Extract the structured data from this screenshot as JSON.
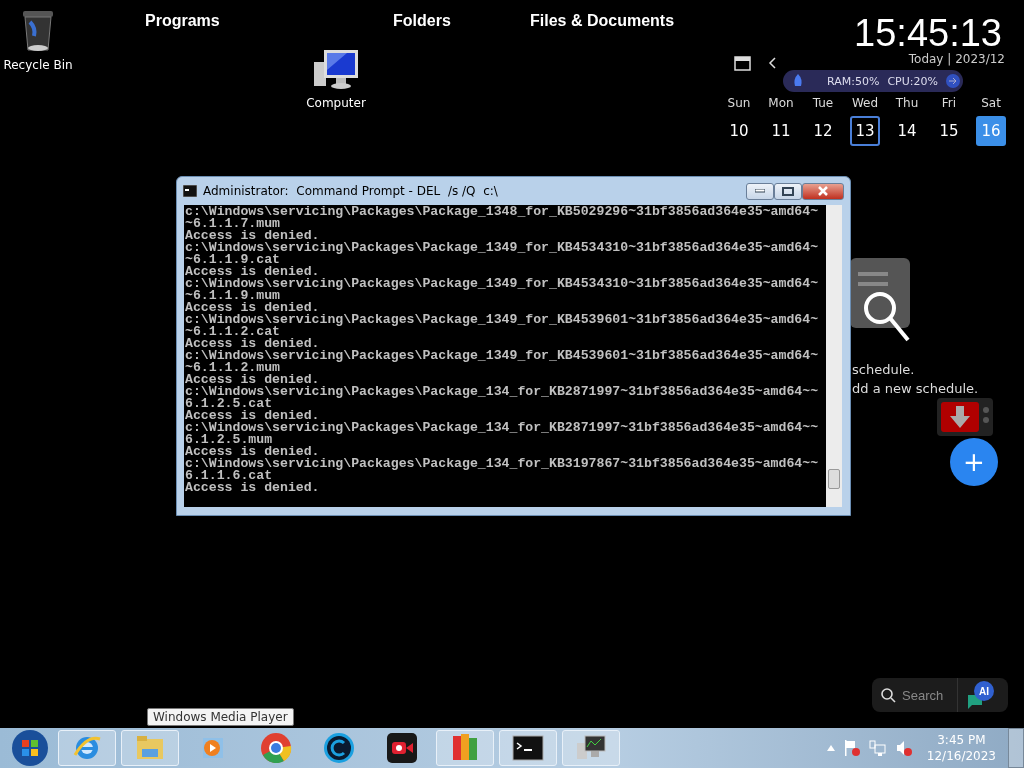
{
  "desktop_icons": [
    {
      "label": "Recycle Bin",
      "kind": "bin"
    },
    {
      "label": "Computer",
      "kind": "computer"
    }
  ],
  "launcher_tabs": [
    "Programs",
    "Folders",
    "Files & Documents"
  ],
  "clock_widget": {
    "time": "15:45:13",
    "header": "Today | 2023/12",
    "system_monitor": {
      "ram": "RAM:50%",
      "cpu": "CPU:20%"
    },
    "weekdays": [
      "Sun",
      "Mon",
      "Tue",
      "Wed",
      "Thu",
      "Fri",
      "Sat"
    ],
    "days": [
      {
        "day": "10",
        "today": false,
        "selected": false
      },
      {
        "day": "11",
        "today": false,
        "selected": false
      },
      {
        "day": "12",
        "today": false,
        "selected": false
      },
      {
        "day": "13",
        "today": true,
        "selected": false
      },
      {
        "day": "14",
        "today": false,
        "selected": false
      },
      {
        "day": "15",
        "today": false,
        "selected": false
      },
      {
        "day": "16",
        "today": false,
        "selected": true
      }
    ]
  },
  "schedule_widget": {
    "lines": [
      "schedule.",
      "dd a new schedule."
    ],
    "add_button": "+"
  },
  "console_window": {
    "title": "Administrator:  Command Prompt - DEL  /s /Q  c:\\",
    "lines": [
      "c:\\Windows\\servicing\\Packages\\Package_1348_for_KB5029296~31bf3856ad364e35~amd64~",
      "~6.1.1.7.mum",
      "Access is denied.",
      "c:\\Windows\\servicing\\Packages\\Package_1349_for_KB4534310~31bf3856ad364e35~amd64~",
      "~6.1.1.9.cat",
      "Access is denied.",
      "c:\\Windows\\servicing\\Packages\\Package_1349_for_KB4534310~31bf3856ad364e35~amd64~",
      "~6.1.1.9.mum",
      "Access is denied.",
      "c:\\Windows\\servicing\\Packages\\Package_1349_for_KB4539601~31bf3856ad364e35~amd64~",
      "~6.1.1.2.cat",
      "Access is denied.",
      "c:\\Windows\\servicing\\Packages\\Package_1349_for_KB4539601~31bf3856ad364e35~amd64~",
      "~6.1.1.2.mum",
      "Access is denied.",
      "c:\\Windows\\servicing\\Packages\\Package_134_for_KB2871997~31bf3856ad364e35~amd64~~",
      "6.1.2.5.cat",
      "Access is denied.",
      "c:\\Windows\\servicing\\Packages\\Package_134_for_KB2871997~31bf3856ad364e35~amd64~~",
      "6.1.2.5.mum",
      "Access is denied.",
      "c:\\Windows\\servicing\\Packages\\Package_134_for_KB3197867~31bf3856ad364e35~amd64~~",
      "6.1.1.6.cat",
      "Access is denied."
    ]
  },
  "search_widget": {
    "placeholder": "Search",
    "ai_badge": "AI"
  },
  "tooltip": "Windows Media Player",
  "taskbar": {
    "apps": [
      {
        "kind": "ie",
        "active": true
      },
      {
        "kind": "explorer",
        "active": true
      },
      {
        "kind": "media",
        "active": false
      },
      {
        "kind": "chrome",
        "active": false
      },
      {
        "kind": "ccleaner",
        "active": false
      },
      {
        "kind": "recorder",
        "active": false
      },
      {
        "kind": "avg",
        "active": true
      },
      {
        "kind": "cmd",
        "active": true
      },
      {
        "kind": "network",
        "active": true
      }
    ],
    "time": "3:45 PM",
    "date": "12/16/2023"
  }
}
